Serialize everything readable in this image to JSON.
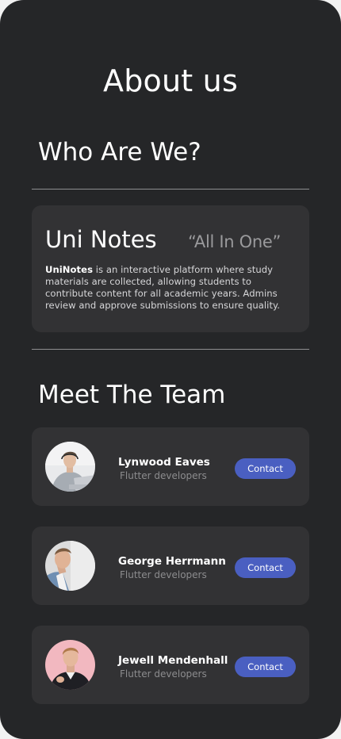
{
  "page": {
    "title": "About us"
  },
  "who": {
    "title": "Who Are We?",
    "brand": "Uni Notes",
    "tagline": "“All In One”",
    "description_bold": "UniNotes",
    "description_rest": " is an interactive platform where study materials are collected, allowing students to contribute content for all academic years. Admins review and approve submissions to ensure quality."
  },
  "team": {
    "title": "Meet The Team",
    "members": [
      {
        "name": "Lynwood Eaves",
        "role": "Flutter developers",
        "contact_label": "Contact"
      },
      {
        "name": "George Herrmann",
        "role": "Flutter developers",
        "contact_label": "Contact"
      },
      {
        "name": "Jewell Mendenhall",
        "role": "Flutter developers",
        "contact_label": "Contact"
      }
    ]
  },
  "colors": {
    "background": "#252628",
    "card": "#323234",
    "accent": "#4a5fc1",
    "divider": "#8e8e90"
  }
}
